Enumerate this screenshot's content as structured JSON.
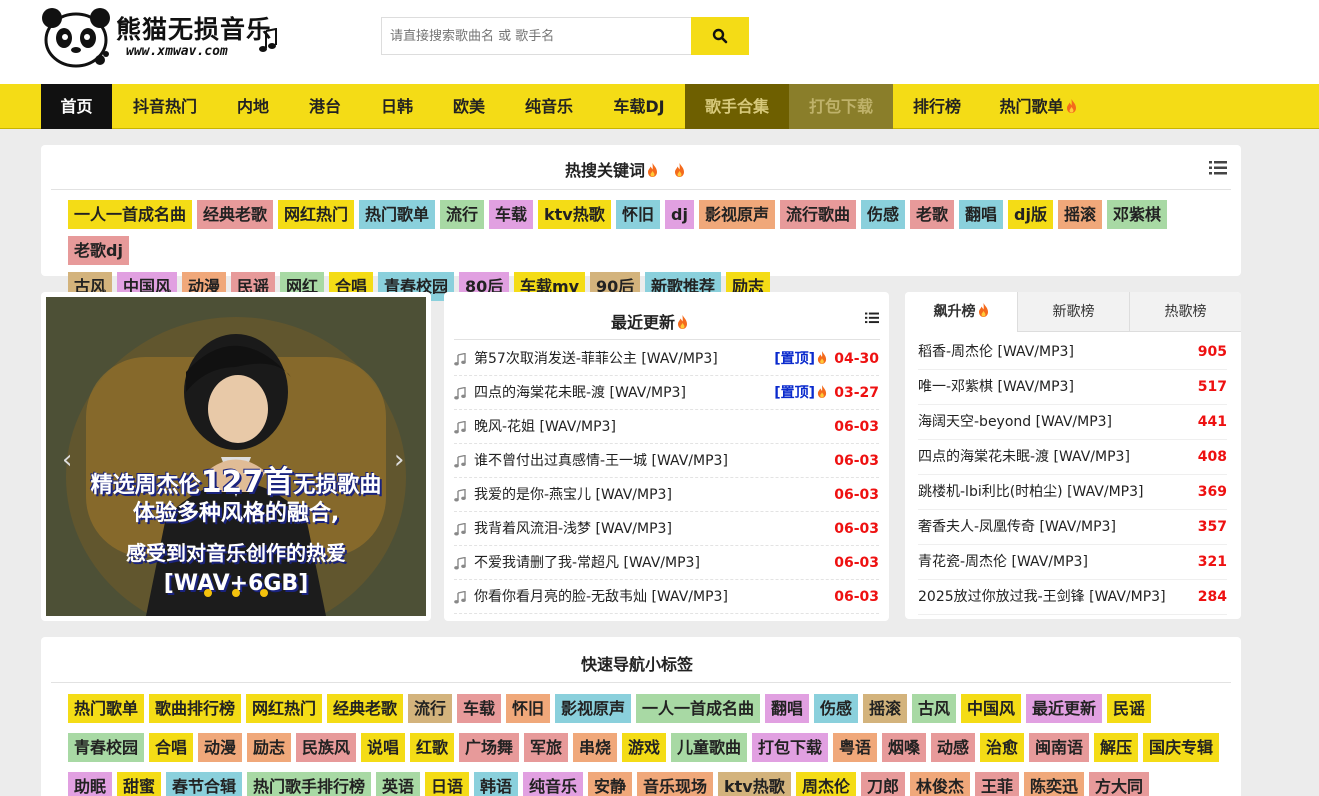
{
  "site": {
    "name": "熊猫无损音乐",
    "url": "www.xmwav.com"
  },
  "search": {
    "placeholder": "请直接搜索歌曲名 或 歌手名"
  },
  "nav": [
    "首页",
    "抖音热门",
    "内地",
    "港台",
    "日韩",
    "欧美",
    "纯音乐",
    "车载DJ",
    "歌手合集",
    "打包下载",
    "排行榜",
    "热门歌单"
  ],
  "hot_keywords": {
    "title": "热搜关键词",
    "tags": [
      "一人一首成名曲",
      "经典老歌",
      "网红热门",
      "热门歌单",
      "流行",
      "车载",
      "ktv热歌",
      "怀旧",
      "dj",
      "影视原声",
      "流行歌曲",
      "伤感",
      "老歌",
      "翻唱",
      "dj版",
      "摇滚",
      "邓紫棋",
      "老歌dj",
      "古风",
      "中国风",
      "动漫",
      "民谣",
      "网红",
      "合唱",
      "青春校园",
      "80后",
      "车载mv",
      "90后",
      "新歌推荐",
      "励志"
    ]
  },
  "banner": {
    "line1a": "精选周杰伦",
    "line1b": "127首",
    "line1c": "无损歌曲",
    "line2": "体验多种风格的融合,",
    "line3": "感受到对音乐创作的热爱",
    "line4": "[WAV+6GB]"
  },
  "recent": {
    "title": "最近更新",
    "top_label": "[置顶]",
    "items": [
      {
        "title": "第57次取消发送-菲菲公主 [WAV/MP3]",
        "date": "04-30",
        "pinned": true
      },
      {
        "title": "四点的海棠花未眠-渡 [WAV/MP3]",
        "date": "03-27",
        "pinned": true
      },
      {
        "title": "晚风-花姐 [WAV/MP3]",
        "date": "06-03",
        "pinned": false
      },
      {
        "title": "谁不曾付出过真感情-王一城 [WAV/MP3]",
        "date": "06-03",
        "pinned": false
      },
      {
        "title": "我爱的是你-燕宝儿 [WAV/MP3]",
        "date": "06-03",
        "pinned": false
      },
      {
        "title": "我背着风流泪-浅梦 [WAV/MP3]",
        "date": "06-03",
        "pinned": false
      },
      {
        "title": "不爱我请删了我-常超凡 [WAV/MP3]",
        "date": "06-03",
        "pinned": false
      },
      {
        "title": "你看你看月亮的脸-无敌韦灿 [WAV/MP3]",
        "date": "06-03",
        "pinned": false
      }
    ]
  },
  "charts": {
    "tabs": [
      "飙升榜",
      "新歌榜",
      "热歌榜"
    ],
    "items": [
      {
        "title": "稻香-周杰伦 [WAV/MP3]",
        "count": "905"
      },
      {
        "title": "唯一-邓紫棋 [WAV/MP3]",
        "count": "517"
      },
      {
        "title": "海阔天空-beyond [WAV/MP3]",
        "count": "441"
      },
      {
        "title": "四点的海棠花未眠-渡 [WAV/MP3]",
        "count": "408"
      },
      {
        "title": "跳楼机-lbi利比(时柏尘) [WAV/MP3]",
        "count": "369"
      },
      {
        "title": "奢香夫人-凤凰传奇 [WAV/MP3]",
        "count": "357"
      },
      {
        "title": "青花瓷-周杰伦 [WAV/MP3]",
        "count": "321"
      },
      {
        "title": "2025放过你放过我-王剑锋 [WAV/MP3]",
        "count": "284"
      }
    ]
  },
  "quick_nav": {
    "title": "快速导航小标签",
    "tags": [
      "热门歌单",
      "歌曲排行榜",
      "网红热门",
      "经典老歌",
      "流行",
      "车载",
      "怀旧",
      "影视原声",
      "一人一首成名曲",
      "翻唱",
      "伤感",
      "摇滚",
      "古风",
      "中国风",
      "最近更新",
      "民谣",
      "青春校园",
      "合唱",
      "动漫",
      "励志",
      "民族风",
      "说唱",
      "红歌",
      "广场舞",
      "军旅",
      "串烧",
      "游戏",
      "儿童歌曲",
      "打包下载",
      "粤语",
      "烟嗓",
      "动感",
      "治愈",
      "闽南语",
      "解压",
      "国庆专辑",
      "助眠",
      "甜蜜",
      "春节合辑",
      "热门歌手排行榜",
      "英语",
      "日语",
      "韩语",
      "纯音乐",
      "安静",
      "音乐现场",
      "ktv热歌",
      "周杰伦",
      "刀郎",
      "林俊杰",
      "王菲",
      "陈奕迅",
      "方大同"
    ]
  },
  "colors": {
    "accent": "#f4dc16",
    "tag_yellow": "#f4dc16",
    "tag_pink": "#e79a9a",
    "tag_blue": "#8ad0dc",
    "tag_green": "#a8d9a4",
    "tag_purple": "#e1a0e1",
    "tag_tan": "#d3b37c",
    "tag_orange": "#f0a87a",
    "date_red": "#e11111",
    "pinned_blue": "#0a2acd"
  }
}
